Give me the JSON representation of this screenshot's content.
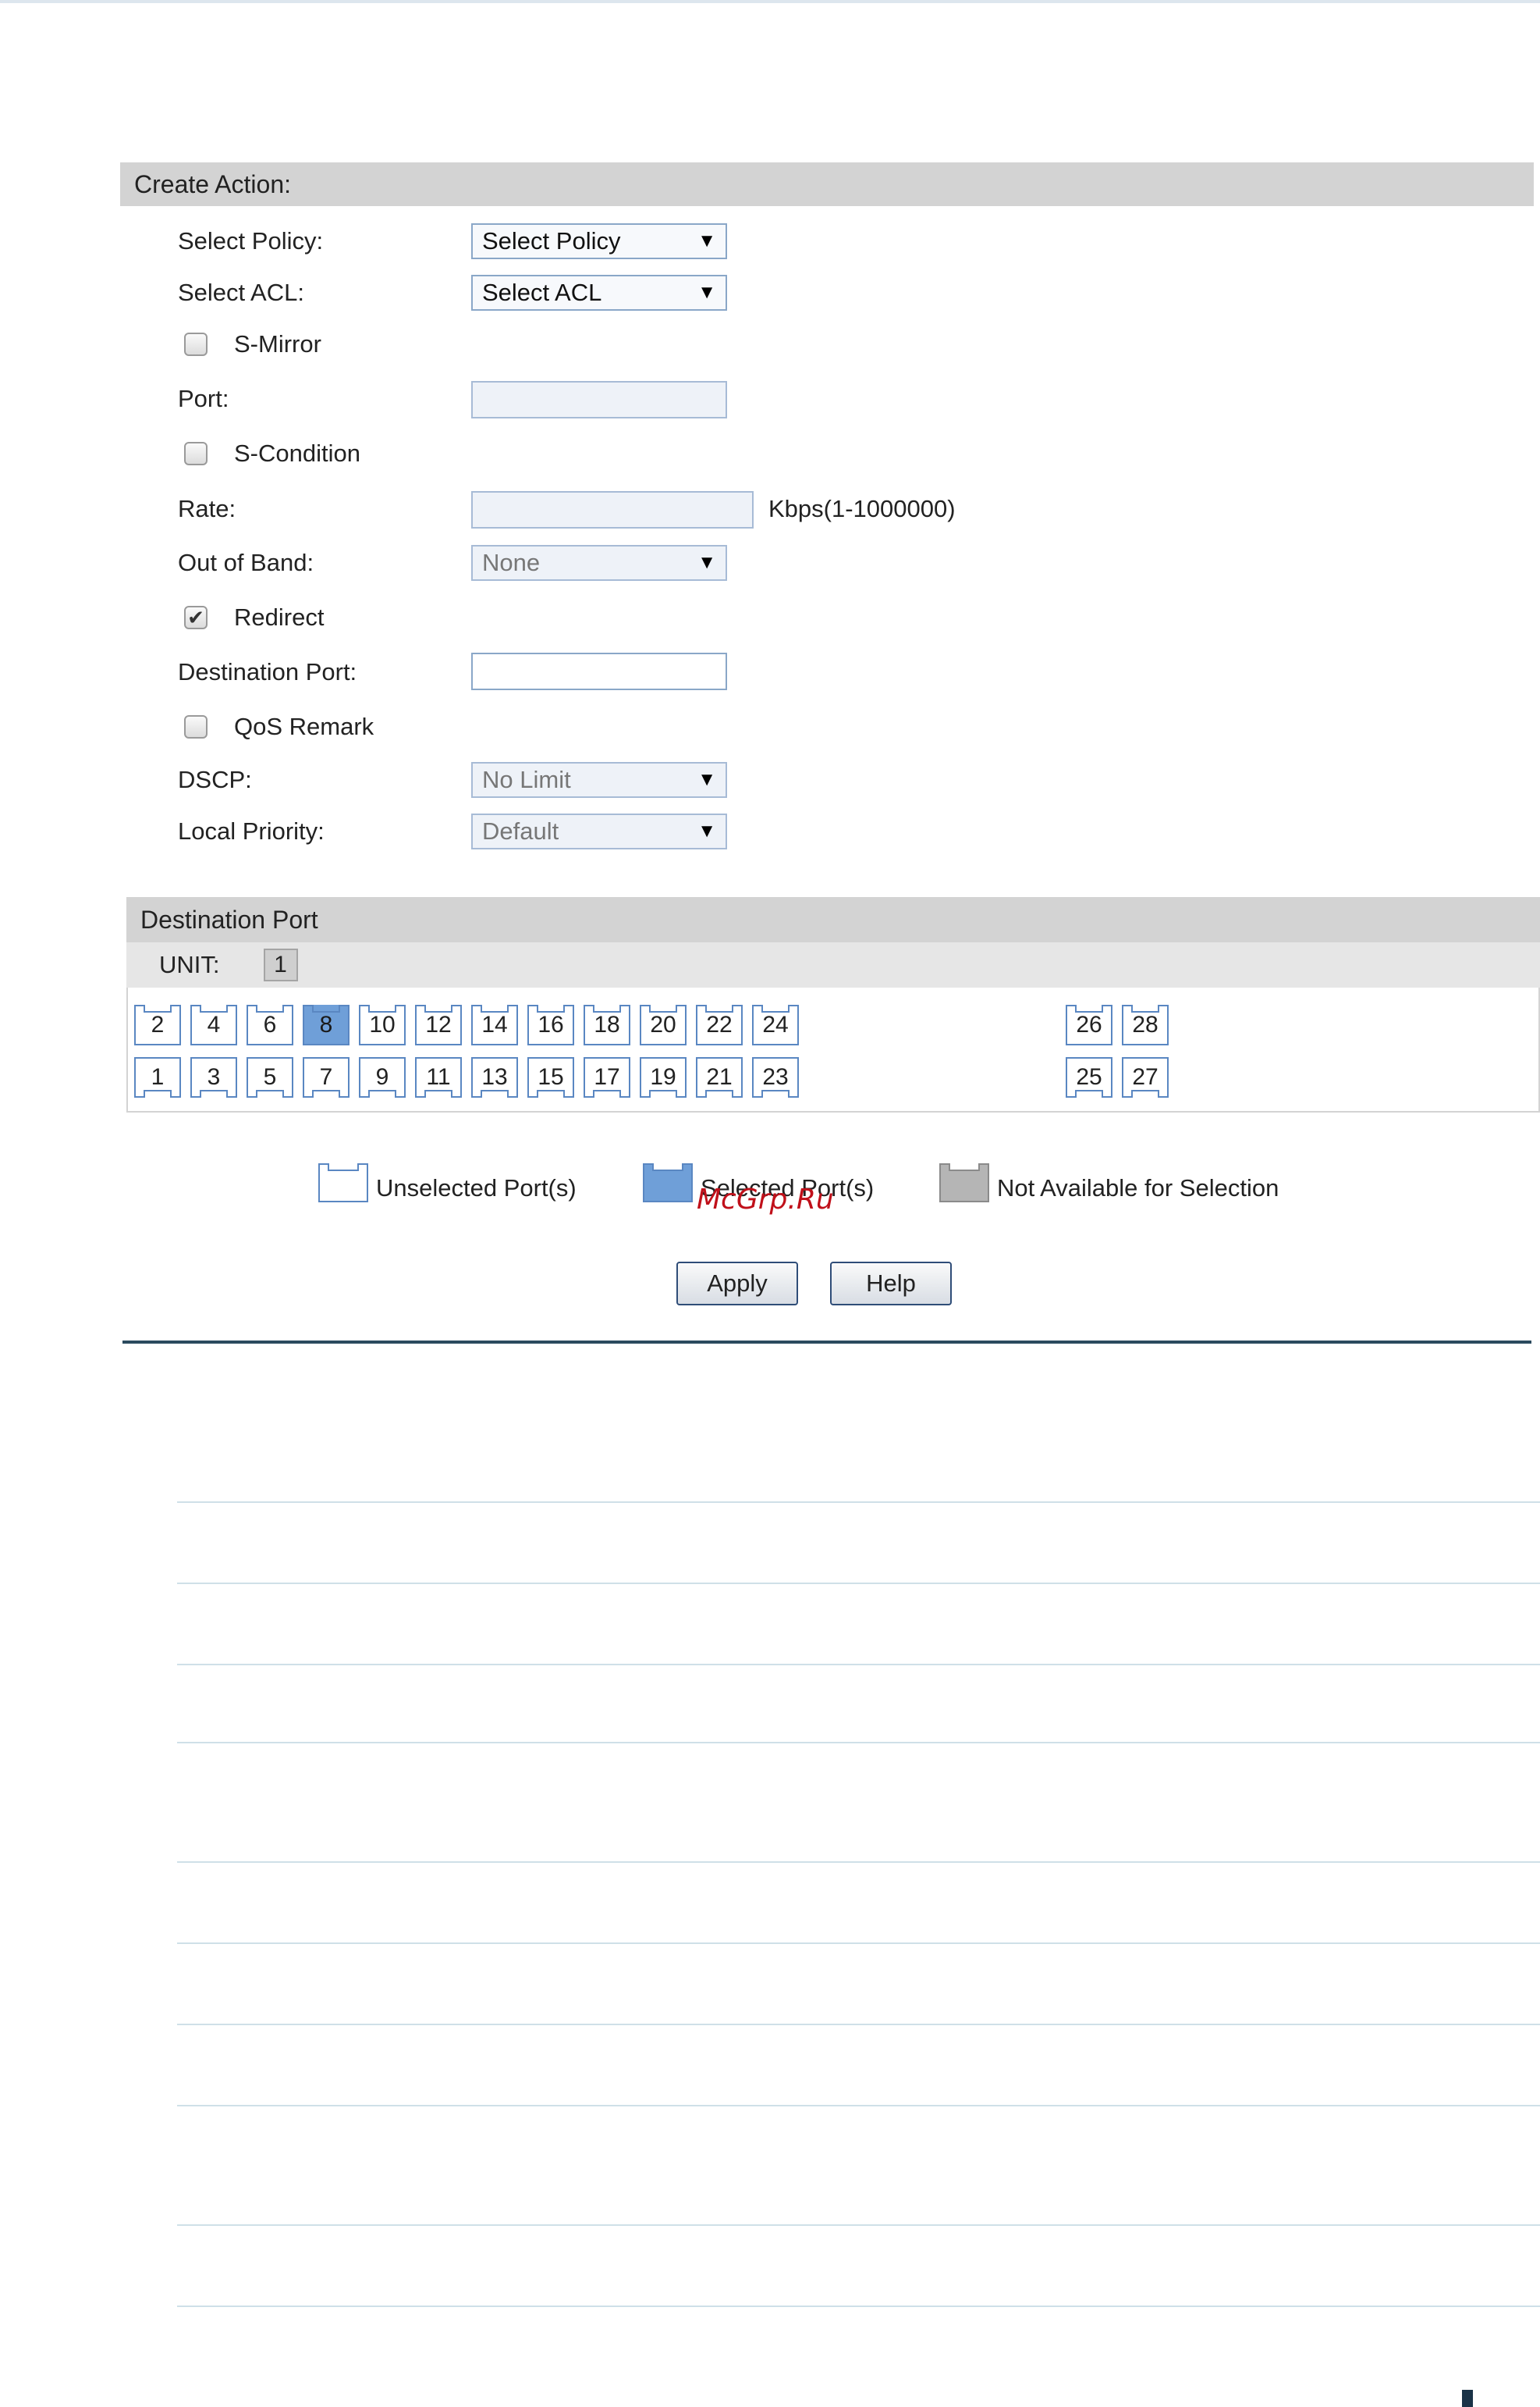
{
  "create_action": {
    "header": "Create Action:",
    "select_policy": {
      "label": "Select Policy:",
      "value": "Select Policy"
    },
    "select_acl": {
      "label": "Select ACL:",
      "value": "Select ACL"
    },
    "s_mirror": {
      "label": "S-Mirror",
      "checked": false
    },
    "port": {
      "label": "Port:",
      "value": ""
    },
    "s_condition": {
      "label": "S-Condition",
      "checked": false
    },
    "rate": {
      "label": "Rate:",
      "value": "",
      "unit": "Kbps(1-1000000)"
    },
    "out_of_band": {
      "label": "Out of Band:",
      "value": "None"
    },
    "redirect": {
      "label": "Redirect",
      "checked": true,
      "check_glyph": "✔"
    },
    "destination_port": {
      "label": "Destination Port:",
      "value": ""
    },
    "qos_remark": {
      "label": "QoS Remark",
      "checked": false
    },
    "dscp": {
      "label": "DSCP:",
      "value": "No Limit"
    },
    "local_priority": {
      "label": "Local Priority:",
      "value": "Default"
    }
  },
  "destination_port_panel": {
    "header": "Destination Port",
    "unit_label": "UNIT:",
    "unit_value": "1",
    "even_ports": [
      "2",
      "4",
      "6",
      "8",
      "10",
      "12",
      "14",
      "16",
      "18",
      "20",
      "22",
      "24"
    ],
    "odd_ports": [
      "1",
      "3",
      "5",
      "7",
      "9",
      "11",
      "13",
      "15",
      "17",
      "19",
      "21",
      "23"
    ],
    "right_even_ports": [
      "26",
      "28"
    ],
    "right_odd_ports": [
      "25",
      "27"
    ],
    "selected_ports": [
      "8"
    ]
  },
  "legend": {
    "unselected": "Unselected Port(s)",
    "selected": "Selected Port(s)",
    "not_available": "Not Available for Selection"
  },
  "watermark": "McGrp.Ru",
  "buttons": {
    "apply": "Apply",
    "help": "Help"
  },
  "icons": {
    "caret": "▼",
    "port_shape": "port-icon"
  },
  "colors": {
    "header_bg": "#d3d3d3",
    "selected_port": "#6f9fd8",
    "port_border": "#5a87c2",
    "not_available": "#b5b5b5"
  }
}
